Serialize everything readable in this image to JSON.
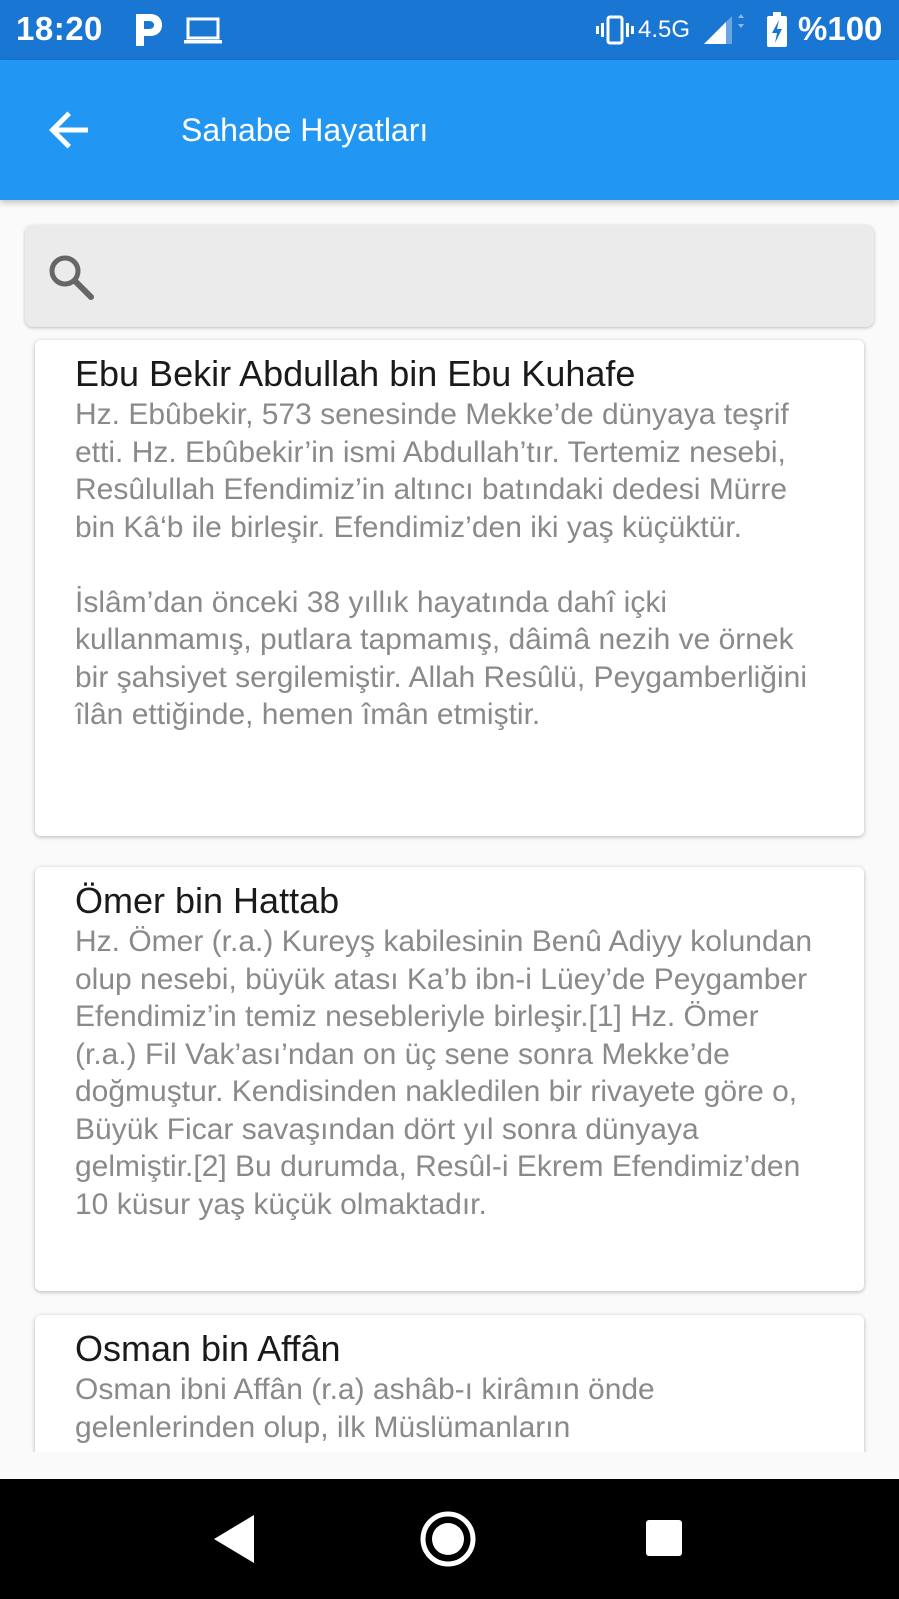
{
  "status_bar": {
    "time": "18:20",
    "network": "4.5G",
    "battery": "%100",
    "icons": [
      "parking-app-icon",
      "laptop-icon",
      "vibrate-icon",
      "signal-icon",
      "battery-charging-icon"
    ]
  },
  "app_bar": {
    "title": "Sahabe Hayatları",
    "back_icon": "arrow-back-icon",
    "color": "#2196f3"
  },
  "search": {
    "icon": "search-icon",
    "value": "",
    "placeholder": ""
  },
  "items": [
    {
      "title": "Ebu Bekir Abdullah bin Ebu Kuhafe",
      "body": "Hz. Ebûbekir, 573 senesinde Mekke’de dünyaya teşrif etti. Hz. Ebûbekir’in ismi Abdullah’tır. Tertemiz nesebi, Resûlullah Efendimiz’in altıncı batındaki dedesi Mürre bin Kâ‘b ile birleşir. Efendimiz’den iki yaş küçüktür.\n\nİslâm’dan önceki 38 yıllık hayatında dahî içki kullanmamış, putlara tapmamış, dâimâ nezih ve örnek bir şahsiyet sergilemiştir. Allah Resûlü, Peygamberliğini îlân ettiğinde, hemen îmân etmiştir."
    },
    {
      "title": "Ömer bin Hattab",
      "body": "Hz. Ömer (r.a.) Kureyş kabilesinin Benû Adiyy kolundan olup nesebi, büyük atası Ka’b ibn-i Lüey’de Peygamber Efendimiz’in temiz nesebleriyle birleşir.[1] Hz. Ömer (r.a.) Fil Vak’ası’ndan on üç sene sonra Mekke’de doğmuştur. Kendisinden nakledilen bir rivayete göre o, Büyük Ficar savaşından dört yıl sonra dünyaya gelmiştir.[2] Bu durumda, Resûl-i Ekrem Efendimiz’den 10 küsur yaş küçük olmaktadır."
    },
    {
      "title": "Osman bin Affân",
      "body": "Osman ibni Affân (r.a) ashâb-ı kirâmın önde gelenlerinden olup, ilk Müslümanların"
    }
  ],
  "nav_bar": {
    "icons": [
      "nav-back-icon",
      "nav-home-icon",
      "nav-recents-icon"
    ]
  }
}
